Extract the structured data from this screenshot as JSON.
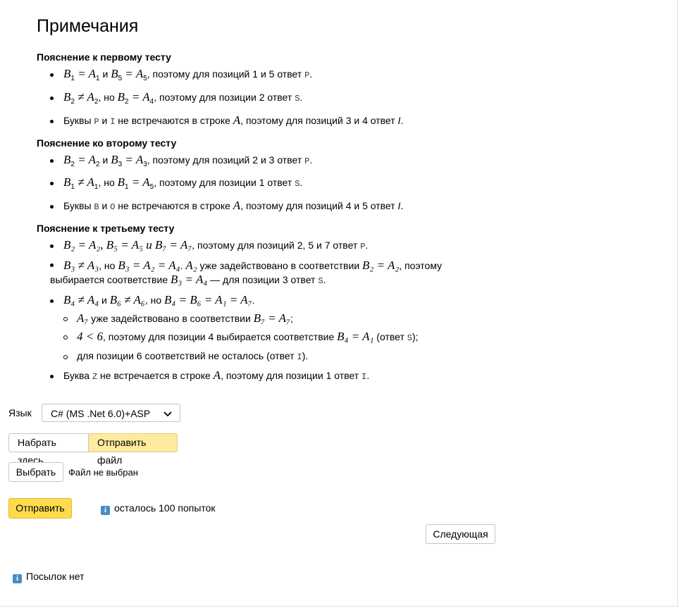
{
  "title": "Примечания",
  "sections": [
    {
      "heading": "Пояснение к первому тесту",
      "items": [
        {
          "math1": "B",
          "s1": "1",
          "eq1": " = ",
          "math2": "A",
          "s2": "1",
          "mid": " и ",
          "math3": "B",
          "s3": "5",
          "eq2": " = ",
          "math4": "A",
          "s4": "5",
          "text": ", поэтому для позиций 1 и 5 ответ ",
          "code": "P",
          "end": "."
        },
        {
          "math1": "B",
          "s1": "2",
          "eq1": " ≠ ",
          "math2": "A",
          "s2": "2",
          "mid": ", но ",
          "math3": "B",
          "s3": "2",
          "eq2": " = ",
          "math4": "A",
          "s4": "4",
          "text": ", поэтому для позиции 2 ответ ",
          "code": "S",
          "end": "."
        },
        {
          "prefix": "Буквы ",
          "code1": "P",
          "and": " и ",
          "code2": "I",
          "text": " не встречаются в строке ",
          "math": "A",
          "text2": ", поэтому для позиций 3 и 4 ответ ",
          "ans": "I",
          "end": "."
        }
      ]
    },
    {
      "heading": "Пояснение ко второму тесту",
      "items": [
        {
          "math1": "B",
          "s1": "2",
          "eq1": " = ",
          "math2": "A",
          "s2": "2",
          "mid": " и ",
          "math3": "B",
          "s3": "3",
          "eq2": " = ",
          "math4": "A",
          "s4": "3",
          "text": ", поэтому для позиций 2 и 3 ответ ",
          "code": "P",
          "end": "."
        },
        {
          "math1": "B",
          "s1": "1",
          "eq1": " ≠ ",
          "math2": "A",
          "s2": "1",
          "mid": ", но ",
          "math3": "B",
          "s3": "1",
          "eq2": " = ",
          "math4": "A",
          "s4": "5",
          "text": ", поэтому для позиции 1 ответ ",
          "code": "S",
          "end": "."
        },
        {
          "prefix": "Буквы ",
          "code1": "B",
          "and": " и ",
          "code2": "O",
          "text": " не встречаются в строке ",
          "math": "A",
          "text2": ", поэтому для позиций 4 и 5 ответ ",
          "ans": "I",
          "end": "."
        }
      ]
    },
    {
      "heading": "Пояснение к третьему тесту",
      "item1": {
        "pre": "B₂ = A₂, B₅ = A₅ и B₇ = A₇",
        "text": ", поэтому для позиций 2, 5 и 7 ответ ",
        "code": "P",
        "end": "."
      },
      "item2": {
        "line1_math": "B₃ ≠ A₃",
        "line1_text": ", но ",
        "line1_math2": "B₃ = A₂ = A₄",
        "line1_text2": ". ",
        "line1_math3": "A₂",
        "line1_text3": " уже задействовано в соответствии ",
        "line1_math4": "B₂ = A₂",
        "line1_text4": ", поэтому",
        "line2_text": "выбирается соответствие ",
        "line2_math": "B₃ = A₄",
        "line2_text2": " — для позиции 3 ответ ",
        "line2_code": "S",
        "end": "."
      },
      "item3": {
        "math": "B₄ ≠ A₄",
        "mid": " и ",
        "math2": "B₆ ≠ A₆",
        "text": ", но ",
        "math3": "B₄ = B₆ = A₁ = A₇",
        "end": "."
      },
      "sub": [
        {
          "math": "A₇",
          "text": " уже задействовано в соответствии ",
          "math2": "B₇ = A₇",
          "end": ";"
        },
        {
          "math": "4 < 6",
          "text": ", поэтому для позиции 4 выбирается соответствие ",
          "math2": "B₄ = A₁",
          "text2": " (ответ ",
          "code": "S",
          "end": ");"
        },
        {
          "text": "для позиции 6 соответствий не осталось (ответ ",
          "code": "I",
          "end": ")."
        }
      ],
      "item4": {
        "prefix": "Буква ",
        "code": "Z",
        "text": " не встречается в строке ",
        "math": "A",
        "text2": ", поэтому для позиции 1 ответ ",
        "code2": "I",
        "end": "."
      }
    }
  ],
  "form": {
    "lang_label": "Язык",
    "lang_value": "C# (MS .Net 6.0)+ASP",
    "tab_type": "Набрать здесь",
    "tab_file": "Отправить файл",
    "choose_label": "Выбрать",
    "file_status": "Файл не выбран",
    "submit_label": "Отправить",
    "attempts_text": "осталось 100 попыток",
    "next_label": "Следующая",
    "no_submissions": "Посылок нет"
  },
  "colors": {
    "accent": "#ffdb4d",
    "active_tab": "#ffeba0",
    "info": "#4a8cc2"
  }
}
